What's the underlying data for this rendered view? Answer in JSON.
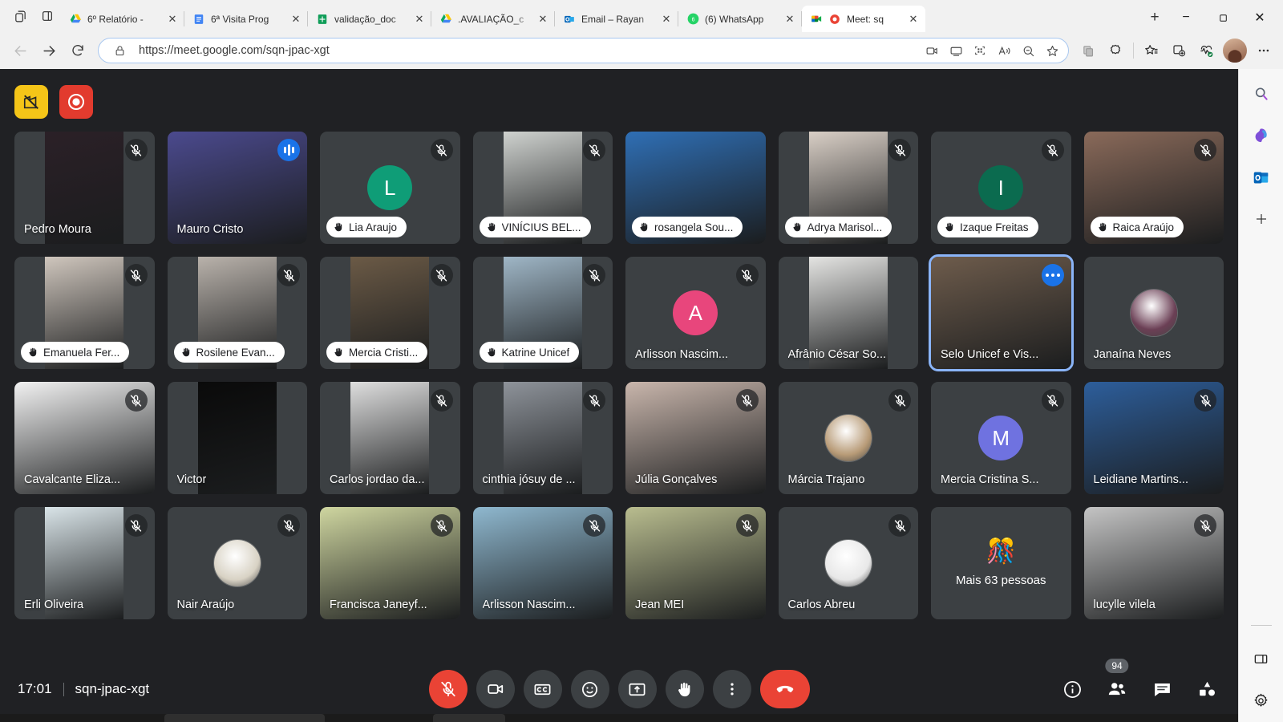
{
  "browser": {
    "window_icons": [
      "tab-actions-icon",
      "split-screen-icon"
    ],
    "tabs": [
      {
        "title": "6º Relatório -",
        "favicon": "google-drive-icon",
        "active": false
      },
      {
        "title": "6ª Visita Prog",
        "favicon": "google-docs-icon",
        "active": false
      },
      {
        "title": "validação_doc",
        "favicon": "google-sheets-icon",
        "active": false
      },
      {
        "title": ".AVALIAÇÃO_c",
        "favicon": "google-drive-icon",
        "active": false
      },
      {
        "title": "Email – Rayan",
        "favicon": "outlook-icon",
        "active": false
      },
      {
        "title": "(6) WhatsApp",
        "favicon": "whatsapp-icon",
        "active": false
      },
      {
        "title": "Meet: sq",
        "favicon": "google-meet-icon",
        "active": true
      }
    ],
    "newtab_label": "+",
    "window_controls": {
      "minimize": "−",
      "maximize": "❐",
      "close": "✕"
    },
    "nav": {
      "back": "back-icon",
      "forward": "forward-icon",
      "reload": "reload-icon"
    },
    "omnibox": {
      "lock": "lock-icon",
      "url": "https://meet.google.com/sqn-jpac-xgt",
      "buttons": [
        "camera-permission-icon",
        "cast-icon",
        "qr-code-icon",
        "read-aloud-icon",
        "zoom-out-icon",
        "favorite-star-icon"
      ]
    },
    "toolbar_buttons": [
      "collections-copy-icon",
      "extensions-icon",
      "favorites-icon",
      "split-screen-icon",
      "browser-essentials-icon"
    ],
    "profile": "profile-avatar",
    "settings_more": "more-options-icon"
  },
  "meet": {
    "overlay_buttons": [
      {
        "name": "no-screenshot-icon",
        "color": "#f5c518"
      },
      {
        "name": "record-icon",
        "color": "#e23b2e"
      }
    ],
    "participants": [
      {
        "name": "Pedro Moura",
        "style": "video-narrow",
        "bg": "#2b2027",
        "badge": "mic-off",
        "label": "plain"
      },
      {
        "name": "Mauro Cristo",
        "style": "video-full",
        "bg": "#4b4a8e",
        "badge": "speaking",
        "label": "plain"
      },
      {
        "name": "Lia Araujo",
        "style": "avatar-initial",
        "initial": "L",
        "avatar_color": "#0f9d77",
        "badge": "mic-off",
        "label": "pill-hand"
      },
      {
        "name": "VINÍCIUS BEL...",
        "style": "video-narrow",
        "bg": "#cfd2cf",
        "badge": "mic-off",
        "label": "pill-hand"
      },
      {
        "name": "rosangela Sou...",
        "style": "video-full",
        "bg": "#2f6fb5",
        "badge": "none",
        "label": "pill-hand"
      },
      {
        "name": "Adrya Marisol...",
        "style": "video-narrow",
        "bg": "#d9cfc6",
        "badge": "mic-off",
        "label": "pill-hand"
      },
      {
        "name": "Izaque Freitas",
        "style": "avatar-initial",
        "initial": "I",
        "avatar_color": "#0b6b4f",
        "badge": "mic-off",
        "label": "pill-hand"
      },
      {
        "name": "Raica Araújo",
        "style": "video-full",
        "bg": "#8a6a5a",
        "badge": "mic-off",
        "label": "pill-hand"
      },
      {
        "name": "Emanuela Fer...",
        "style": "video-narrow",
        "bg": "#cfc6bd",
        "badge": "mic-off",
        "label": "pill-hand"
      },
      {
        "name": "Rosilene Evan...",
        "style": "video-narrow",
        "bg": "#b9b2ab",
        "badge": "mic-off",
        "label": "pill-hand"
      },
      {
        "name": "Mercia Cristi...",
        "style": "video-narrow",
        "bg": "#6b5a46",
        "badge": "mic-off",
        "label": "pill-hand"
      },
      {
        "name": "Katrine Unicef",
        "style": "video-narrow",
        "bg": "#9fb6c6",
        "badge": "mic-off",
        "label": "pill-hand"
      },
      {
        "name": "Arlisson Nascim...",
        "style": "avatar-initial",
        "initial": "A",
        "avatar_color": "#e8467c",
        "badge": "mic-off",
        "label": "plain"
      },
      {
        "name": "Afrânio César So...",
        "style": "video-narrow",
        "bg": "#e4e4e2",
        "badge": "none",
        "label": "plain"
      },
      {
        "name": "Selo Unicef e Vis...",
        "style": "video-full",
        "bg": "#6e5c4c",
        "badge": "more",
        "label": "plain",
        "speaking_border": true
      },
      {
        "name": "Janaína Neves",
        "style": "avatar-photo",
        "avatar_color": "#6b3f55",
        "badge": "none",
        "label": "plain"
      },
      {
        "name": "Cavalcante Eliza...",
        "style": "video-full",
        "bg": "#f2f2f2",
        "badge": "mic-off",
        "label": "plain"
      },
      {
        "name": "Victor",
        "style": "video-narrow",
        "bg": "#0a0a0a",
        "badge": "none",
        "label": "plain"
      },
      {
        "name": "Carlos jordao da...",
        "style": "video-narrow",
        "bg": "#dedede",
        "badge": "mic-off",
        "label": "plain"
      },
      {
        "name": "cinthia jósuy de ...",
        "style": "video-narrow",
        "bg": "#8e939a",
        "badge": "mic-off",
        "label": "plain"
      },
      {
        "name": "Júlia Gonçalves",
        "style": "video-full",
        "bg": "#c9b6ac",
        "badge": "mic-off",
        "label": "plain"
      },
      {
        "name": "Márcia Trajano",
        "style": "avatar-photo",
        "avatar_color": "#b89b77",
        "badge": "mic-off",
        "label": "plain"
      },
      {
        "name": "Mercia Cristina S...",
        "style": "avatar-initial",
        "initial": "M",
        "avatar_color": "#6f72e0",
        "badge": "mic-off",
        "label": "plain"
      },
      {
        "name": "Leidiane Martins...",
        "style": "video-full",
        "bg": "#2d5e9b",
        "badge": "mic-off",
        "label": "plain"
      },
      {
        "name": "Erli Oliveira",
        "style": "video-narrow",
        "bg": "#d9e4e8",
        "badge": "mic-off",
        "label": "plain"
      },
      {
        "name": "Nair Araújo",
        "style": "avatar-photo",
        "avatar_color": "#d8d2c4",
        "badge": "mic-off",
        "label": "plain"
      },
      {
        "name": "Francisca Janeyf...",
        "style": "video-full",
        "bg": "#cfd6a0",
        "badge": "mic-off",
        "label": "plain"
      },
      {
        "name": "Arlisson Nascim...",
        "style": "video-full",
        "bg": "#8fb8cf",
        "badge": "mic-off",
        "label": "plain"
      },
      {
        "name": "Jean MEI",
        "style": "video-full",
        "bg": "#b9bd8f",
        "badge": "mic-off",
        "label": "plain"
      },
      {
        "name": "Carlos Abreu",
        "style": "avatar-photo",
        "avatar_color": "#e8e8e8",
        "badge": "mic-off",
        "label": "plain"
      },
      {
        "name": "Mais 63 pessoas",
        "style": "more-people",
        "emoji": "🎊",
        "badge": "none",
        "label": "more"
      },
      {
        "name": "lucylle vilela",
        "style": "video-full",
        "bg": "#c4c4c4",
        "badge": "mic-off",
        "label": "plain"
      }
    ],
    "footer": {
      "time": "17:01",
      "meeting_code": "sqn-jpac-xgt",
      "controls": [
        {
          "name": "microphone-off-button",
          "icon": "mic-off-icon",
          "state": "muted"
        },
        {
          "name": "camera-button",
          "icon": "camera-icon",
          "state": "on"
        },
        {
          "name": "captions-button",
          "icon": "cc-icon",
          "state": "off"
        },
        {
          "name": "reactions-button",
          "icon": "emoji-icon",
          "state": "off"
        },
        {
          "name": "present-screen-button",
          "icon": "present-icon",
          "state": "off"
        },
        {
          "name": "raise-hand-button",
          "icon": "hand-icon",
          "state": "off"
        },
        {
          "name": "more-options-button",
          "icon": "more-vertical-icon",
          "state": "off"
        },
        {
          "name": "leave-call-button",
          "icon": "hangup-icon",
          "state": "danger"
        }
      ],
      "right_controls": [
        {
          "name": "meeting-details-button",
          "icon": "info-icon"
        },
        {
          "name": "participants-button",
          "icon": "people-icon",
          "badge": "94"
        },
        {
          "name": "chat-button",
          "icon": "chat-icon"
        },
        {
          "name": "activities-button",
          "icon": "activities-icon"
        }
      ]
    }
  },
  "edge_sidebar": {
    "items": [
      {
        "name": "sidebar-search-icon",
        "label": "Search"
      },
      {
        "name": "sidebar-copilot-icon",
        "label": "Copilot"
      },
      {
        "name": "sidebar-outlook-icon",
        "label": "Outlook"
      },
      {
        "name": "sidebar-add-icon",
        "label": "+"
      }
    ],
    "bottom_items": [
      {
        "name": "sidebar-toggle-icon",
        "label": "Toggle sidebar"
      },
      {
        "name": "sidebar-settings-icon",
        "label": "Settings"
      }
    ]
  },
  "colors": {
    "meet_bg": "#202124",
    "tile_bg": "#3c4043",
    "accent_blue": "#1a73e8",
    "speaking_border": "#8ab4f8",
    "danger_red": "#ea4335",
    "record_red": "#e23b2e",
    "warn_yellow": "#f5c518"
  }
}
